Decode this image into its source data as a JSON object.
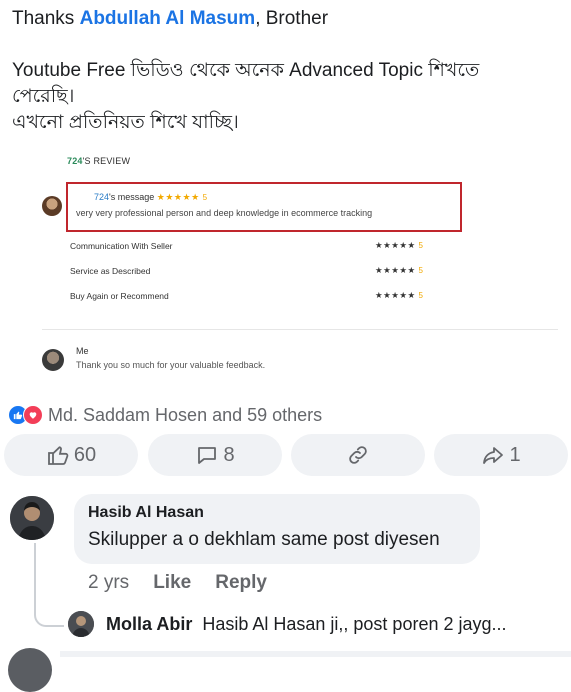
{
  "post": {
    "thanks_prefix": "Thanks ",
    "mention": "Abdullah Al Masum",
    "thanks_suffix": ", Brother",
    "line1": "Youtube Free ভিডিও থেকে অনেক Advanced Topic শিখতে",
    "line2": "পেরেছি।",
    "line3": "এখনো প্রতিনিয়ত শিখে যাচ্ছি।"
  },
  "review": {
    "title_user": "724",
    "title_rest": "'S REVIEW",
    "message_user": "724",
    "message_label": "'s message",
    "message_stars": "★★★★★",
    "message_rating": "5",
    "message_text": "very very professional person and deep knowledge in ecommerce tracking",
    "criteria": [
      {
        "label": "Communication With Seller",
        "stars": "★★★★★",
        "rating": "5"
      },
      {
        "label": "Service as Described",
        "stars": "★★★★★",
        "rating": "5"
      },
      {
        "label": "Buy Again or Recommend",
        "stars": "★★★★★",
        "rating": "5"
      }
    ],
    "me_name": "Me",
    "me_reply": "Thank you so much for your valuable feedback."
  },
  "reactions": {
    "icons": [
      "like-icon",
      "love-icon"
    ],
    "summary": "Md. Saddam Hosen and 59 others"
  },
  "actions": {
    "like_count": "60",
    "comment_count": "8",
    "share_count": "1"
  },
  "comment": {
    "author": "Hasib Al Hasan",
    "text": "Skilupper a o dekhlam same post diyesen",
    "time": "2 yrs",
    "like_label": "Like",
    "reply_label": "Reply"
  },
  "reply": {
    "author": "Molla Abir",
    "text": "Hasib Al Hasan ji,, post poren 2 jayg..."
  },
  "colors": {
    "accent": "#1b74e4",
    "like": "#1877f2",
    "love": "#f33e58",
    "highlight_box": "#c0262d",
    "star": "#f2a900"
  }
}
